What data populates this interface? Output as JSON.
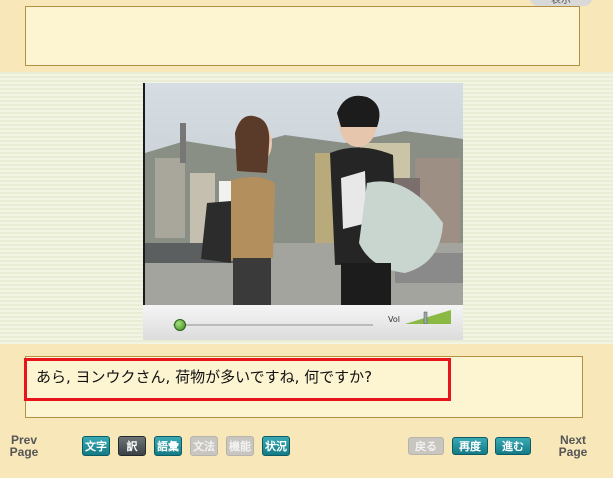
{
  "corner_tab": {
    "label": "表示"
  },
  "video": {
    "volume_label": "Vol"
  },
  "subtitle": {
    "text": "あら, ヨンウクさん,  荷物が多いですね,  何ですか?"
  },
  "nav": {
    "prev_line1": "Prev",
    "prev_line2": "Page",
    "next_line1": "Next",
    "next_line2": "Page"
  },
  "toolbar_left": [
    {
      "label": "文字",
      "state": "active"
    },
    {
      "label": "訳",
      "state": "selected"
    },
    {
      "label": "語彙",
      "state": "active"
    },
    {
      "label": "文法",
      "state": "disabled"
    },
    {
      "label": "機能",
      "state": "disabled"
    },
    {
      "label": "状況",
      "state": "active"
    }
  ],
  "toolbar_right": [
    {
      "label": "戻る",
      "state": "disabled"
    },
    {
      "label": "再度",
      "state": "active"
    },
    {
      "label": "進む",
      "state": "active"
    }
  ],
  "colors": {
    "highlight_border": "#e8141b",
    "button_active": "#1d8d98",
    "panel_fill": "#fdf4d2",
    "band_fill": "#f7e7b9"
  }
}
